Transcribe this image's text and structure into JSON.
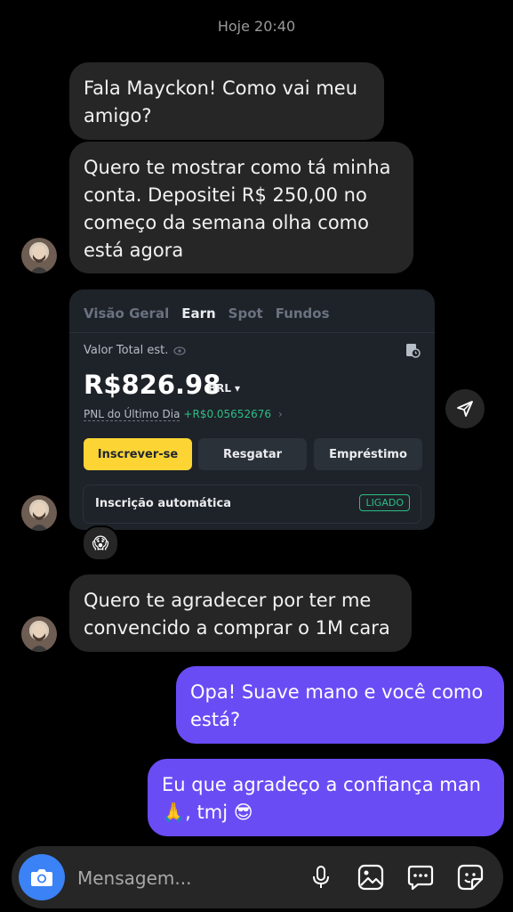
{
  "timestamp": "Hoje 20:40",
  "messages": [
    {
      "from": "them",
      "text": "Fala Mayckon! Como vai meu amigo?"
    },
    {
      "from": "them",
      "text": "Quero te mostrar como tá minha conta. Depositei R$ 250,00 no começo da semana olha como está agora"
    },
    {
      "from": "them",
      "text": "Quero te agradecer por ter me convencido a comprar o 1M cara"
    },
    {
      "from": "me",
      "text": "Opa! Suave mano e você como está?"
    },
    {
      "from": "me",
      "text": "Eu que agradeço a confiança man 🙏, tmj 😎"
    }
  ],
  "shared_card": {
    "tabs": [
      "Visão Geral",
      "Earn",
      "Spot",
      "Fundos"
    ],
    "active_tab": "Earn",
    "total_label": "Valor Total est.",
    "amount": "R$826.98",
    "currency": "BRL",
    "pnl_label": "PNL do Último Dia",
    "pnl_value": "+R$0.05652676",
    "buttons": [
      "Inscrever-se",
      "Resgatar",
      "Empréstimo"
    ],
    "auto_label": "Inscrição automática",
    "auto_status": "LIGADO"
  },
  "reaction": "😱",
  "composer": {
    "placeholder": "Mensagem..."
  },
  "icons": {
    "camera": "camera-icon",
    "mic": "microphone-icon",
    "gallery": "image-icon",
    "chat": "chat-icon",
    "sticker": "sticker-icon",
    "send": "send-icon"
  },
  "colors": {
    "outgoing": "#6a4cf5",
    "incoming": "#262626",
    "accent_yellow": "#fcd535",
    "accent_green": "#2ebd85"
  }
}
